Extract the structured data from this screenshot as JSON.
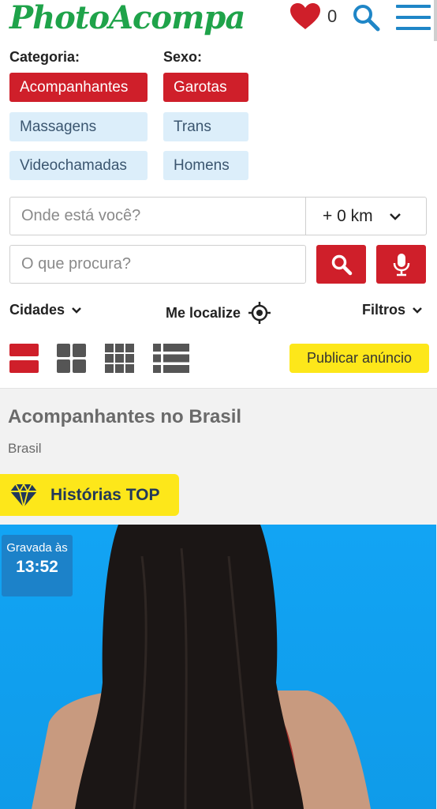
{
  "header": {
    "logo": "PhotoAcompa",
    "favorites_count": "0",
    "icons": [
      "heart-icon",
      "search-icon",
      "menu-icon"
    ],
    "brand_color": "#1fa34a"
  },
  "filters": {
    "category_label": "Categoria:",
    "sex_label": "Sexo:",
    "categories": [
      {
        "label": "Acompanhantes",
        "active": true
      },
      {
        "label": "Massagens",
        "active": false
      },
      {
        "label": "Videochamadas",
        "active": false
      }
    ],
    "sexes": [
      {
        "label": "Garotas",
        "active": true
      },
      {
        "label": "Trans",
        "active": false
      },
      {
        "label": "Homens",
        "active": false
      }
    ],
    "accent_color": "#cf1f2a"
  },
  "search": {
    "location_placeholder": "Onde está você?",
    "radius_value": "+ 0 km",
    "query_placeholder": "O que procura?"
  },
  "links": {
    "cities": "Cidades",
    "locate": "Me localize",
    "filters": "Filtros"
  },
  "view": {
    "modes": [
      "view-large-icon",
      "view-grid-2-icon",
      "view-grid-3-icon",
      "view-list-icon"
    ],
    "publish_label": "Publicar anúncio"
  },
  "section": {
    "title": "Acompanhantes no Brasil",
    "subtitle": "Brasil",
    "stories_label": "Histórias TOP"
  },
  "card": {
    "recorded_label": "Gravada às",
    "recorded_time": "13:52"
  }
}
